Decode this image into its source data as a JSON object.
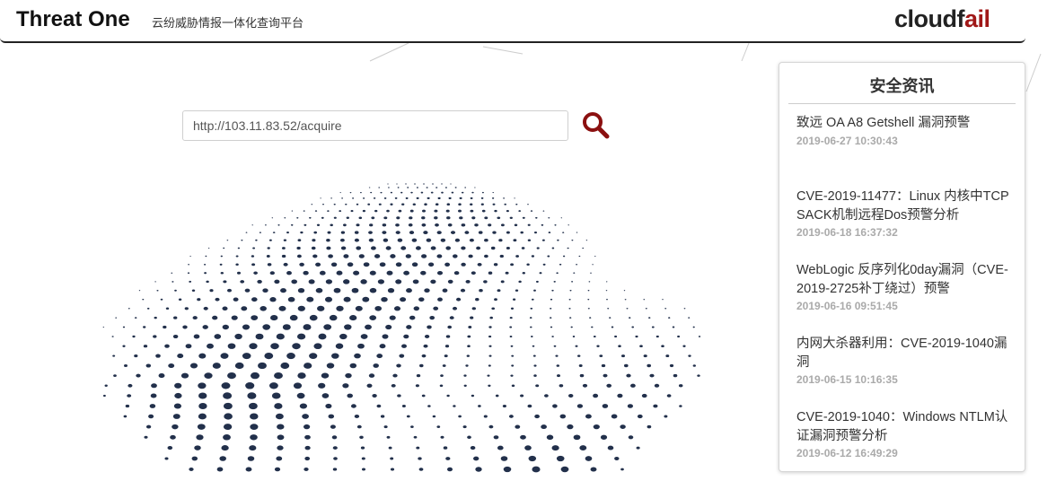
{
  "header": {
    "title": "Threat One",
    "subtitle": "云纷威胁情报一体化查询平台",
    "logo_text_main": "cloudf",
    "logo_text_accent": "ail"
  },
  "search": {
    "value": "http://103.11.83.52/acquire",
    "button_icon": "search-icon",
    "accent_color": "#8b1010"
  },
  "news": {
    "title": "安全资讯",
    "items": [
      {
        "headline": "致远 OA A8 Getshell 漏洞预警",
        "date": "2019-06-27 10:30:43"
      },
      {
        "headline": "CVE-2019-11477：Linux 内核中TCP SACK机制远程Dos预警分析",
        "date": "2019-06-18 16:37:32"
      },
      {
        "headline": "WebLogic 反序列化0day漏洞（CVE-2019-2725补丁绕过）预警",
        "date": "2019-06-16 09:51:45"
      },
      {
        "headline": "内网大杀器利用：CVE-2019-1040漏洞",
        "date": "2019-06-15 10:16:35"
      },
      {
        "headline": "CVE-2019-1040：Windows NTLM认证漏洞预警分析",
        "date": "2019-06-12 16:49:29"
      }
    ]
  },
  "colors": {
    "dot": "#22304b",
    "logo_accent": "#a01818"
  }
}
